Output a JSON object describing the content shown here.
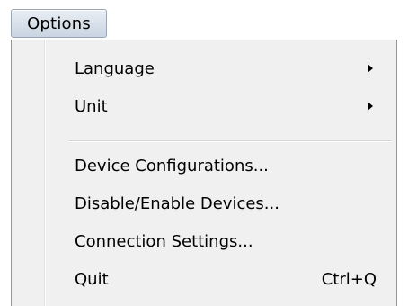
{
  "menubar": {
    "options_label": "Options"
  },
  "menu": {
    "items": [
      {
        "label": "Language",
        "has_submenu": true
      },
      {
        "label": "Unit",
        "has_submenu": true
      },
      {
        "label": "Device Configurations..."
      },
      {
        "label": "Disable/Enable Devices..."
      },
      {
        "label": "Connection Settings..."
      },
      {
        "label": "Quit",
        "shortcut": "Ctrl+Q"
      }
    ]
  },
  "icons": {
    "submenu_arrow": "triangle-right-icon"
  }
}
